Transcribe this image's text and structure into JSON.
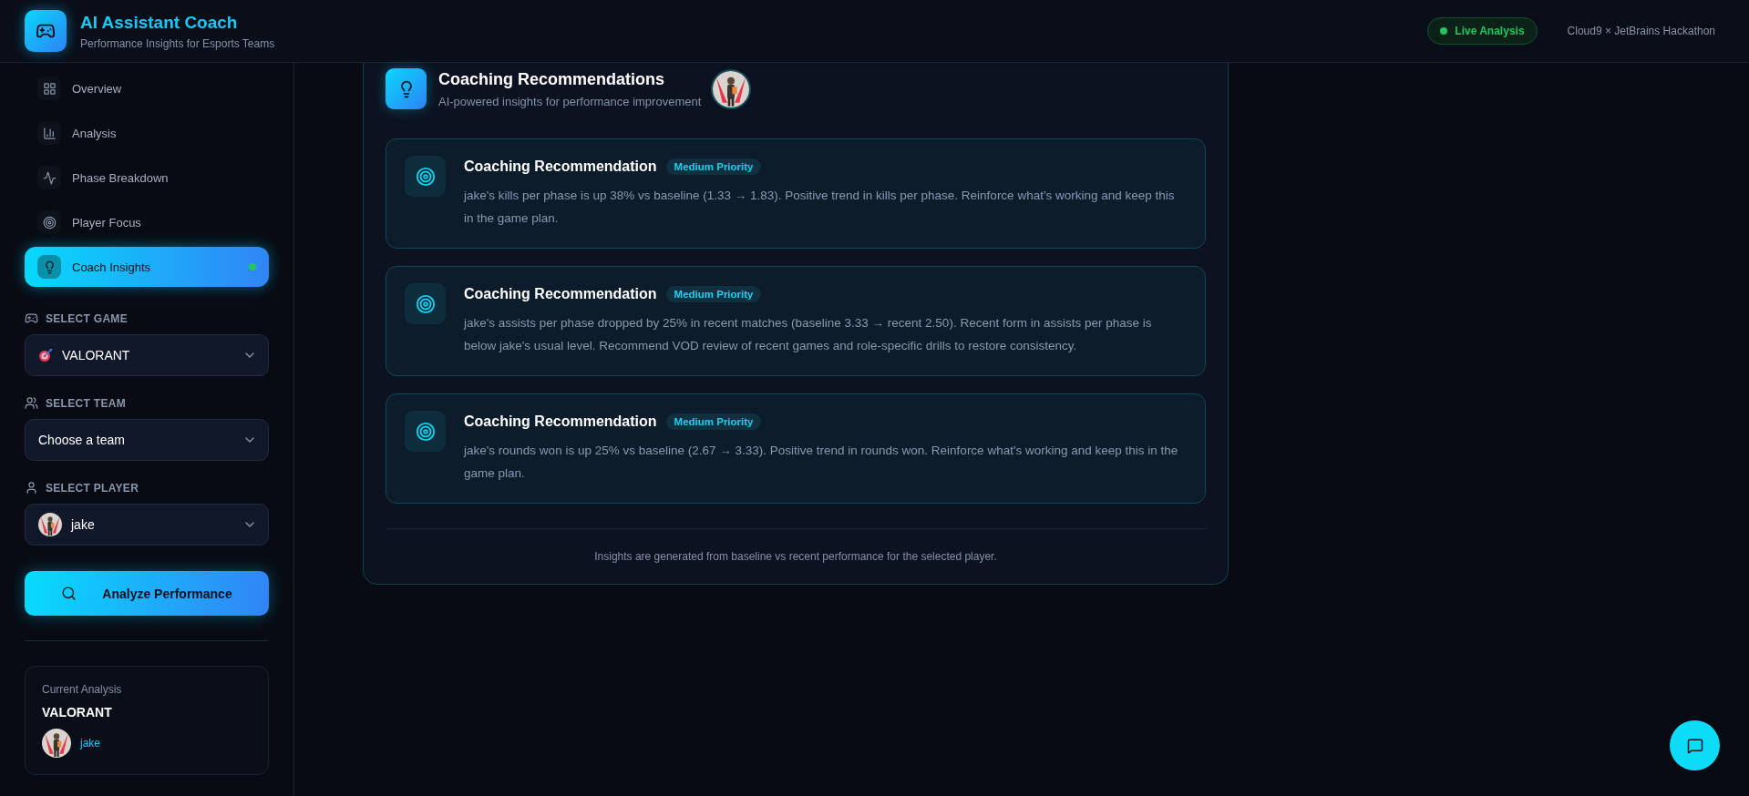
{
  "header": {
    "title": "AI Assistant Coach",
    "subtitle": "Performance Insights for Esports Teams",
    "status": {
      "label": "Live Analysis",
      "live": true
    },
    "credit": "Cloud9 × JetBrains Hackathon"
  },
  "nav": [
    {
      "label": "Overview",
      "kind": "grid",
      "selected": false
    },
    {
      "label": "Analysis",
      "kind": "bars",
      "selected": false
    },
    {
      "label": "Phase Breakdown",
      "kind": "pulse",
      "selected": false
    },
    {
      "label": "Player Focus",
      "kind": "target",
      "selected": false
    },
    {
      "label": "Coach Insights",
      "kind": "bulb",
      "selected": true
    }
  ],
  "selectors": [
    {
      "kind": "game",
      "label": "SELECT GAME",
      "value": "VALORANT"
    },
    {
      "kind": "team",
      "label": "SELECT TEAM",
      "placeholder": "Choose a team"
    },
    {
      "kind": "player",
      "label": "SELECT PLAYER",
      "value": "jake"
    }
  ],
  "analyze_button": "Analyze Performance",
  "current_analysis": {
    "title": "Current Analysis",
    "game": "VALORANT",
    "player": "jake"
  },
  "panel": {
    "title": "Coaching Recommendations",
    "subtitle": "AI-powered insights for performance improvement",
    "recommendations": [
      {
        "title": "Coaching Recommendation",
        "priority": "Medium Priority",
        "text": "jake's kills per phase is up 38% vs baseline (1.33 → 1.83). Positive trend in kills per phase. Reinforce what's working and keep this in the game plan."
      },
      {
        "title": "Coaching Recommendation",
        "priority": "Medium Priority",
        "text": "jake's assists per phase dropped by 25% in recent matches (baseline 3.33 → recent 2.50). Recent form in assists per phase is below jake's usual level. Recommend VOD review of recent games and role-specific drills to restore consistency."
      },
      {
        "title": "Coaching Recommendation",
        "priority": "Medium Priority",
        "text": "jake's rounds won is up 25% vs baseline (2.67 → 3.33). Positive trend in rounds won. Reinforce what's working and keep this in the game plan."
      }
    ],
    "footer": "Insights are generated from baseline vs recent performance for the selected player."
  }
}
